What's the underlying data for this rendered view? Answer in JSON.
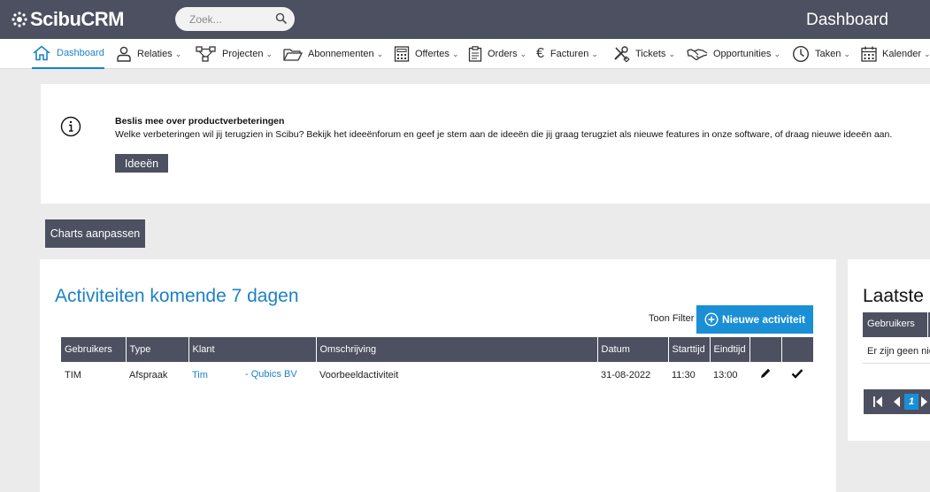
{
  "app": {
    "logo_text": "ScibuCRM",
    "page_title": "Dashboard"
  },
  "search": {
    "placeholder": "Zoek..."
  },
  "nav": {
    "items": [
      {
        "label": "Dashboard",
        "icon": "home-icon"
      },
      {
        "label": "Relaties",
        "icon": "person-icon"
      },
      {
        "label": "Projecten",
        "icon": "project-icon"
      },
      {
        "label": "Abonnementen",
        "icon": "folder-icon"
      },
      {
        "label": "Offertes",
        "icon": "calculator-icon"
      },
      {
        "label": "Orders",
        "icon": "clipboard-icon"
      },
      {
        "label": "Facturen",
        "icon": "euro-icon"
      },
      {
        "label": "Tickets",
        "icon": "tools-icon"
      },
      {
        "label": "Opportunities",
        "icon": "handshake-icon"
      },
      {
        "label": "Taken",
        "icon": "clock-icon"
      },
      {
        "label": "Kalender",
        "icon": "calendar-icon"
      }
    ]
  },
  "info": {
    "title": "Beslis mee over productverbeteringen",
    "text": "Welke verbeteringen wil jij terugzien in Scibu? Bekijk het ideeënforum en geef je stem aan de ideeën die jij graag terugziet als nieuwe features in onze software, of draag nieuwe ideeën aan.",
    "button_label": "Ideeën"
  },
  "charts_button_label": "Charts aanpassen",
  "activities": {
    "title": "Activiteiten komende 7 dagen",
    "filter_label": "Toon Filter",
    "new_button_label": "Nieuwe activiteit",
    "columns": [
      "Gebruikers",
      "Type",
      "Klant",
      "Omschrijving",
      "Datum",
      "Starttijd",
      "Eindtijd"
    ],
    "rows": [
      {
        "user": "TIM",
        "type": "Afspraak",
        "klant_name": "Tim",
        "klant_company": "- Qubics BV",
        "description": "Voorbeeldactiviteit",
        "date": "31-08-2022",
        "start": "11:30",
        "end": "13:00"
      }
    ]
  },
  "latest": {
    "title": "Laatste",
    "column": "Gebruikers",
    "empty_text": "Er zijn geen nieuwe",
    "current_page": "1"
  },
  "colors": {
    "accent": "#1b82c4",
    "button_blue": "#1a8fd6",
    "dark": "#4c5060"
  }
}
